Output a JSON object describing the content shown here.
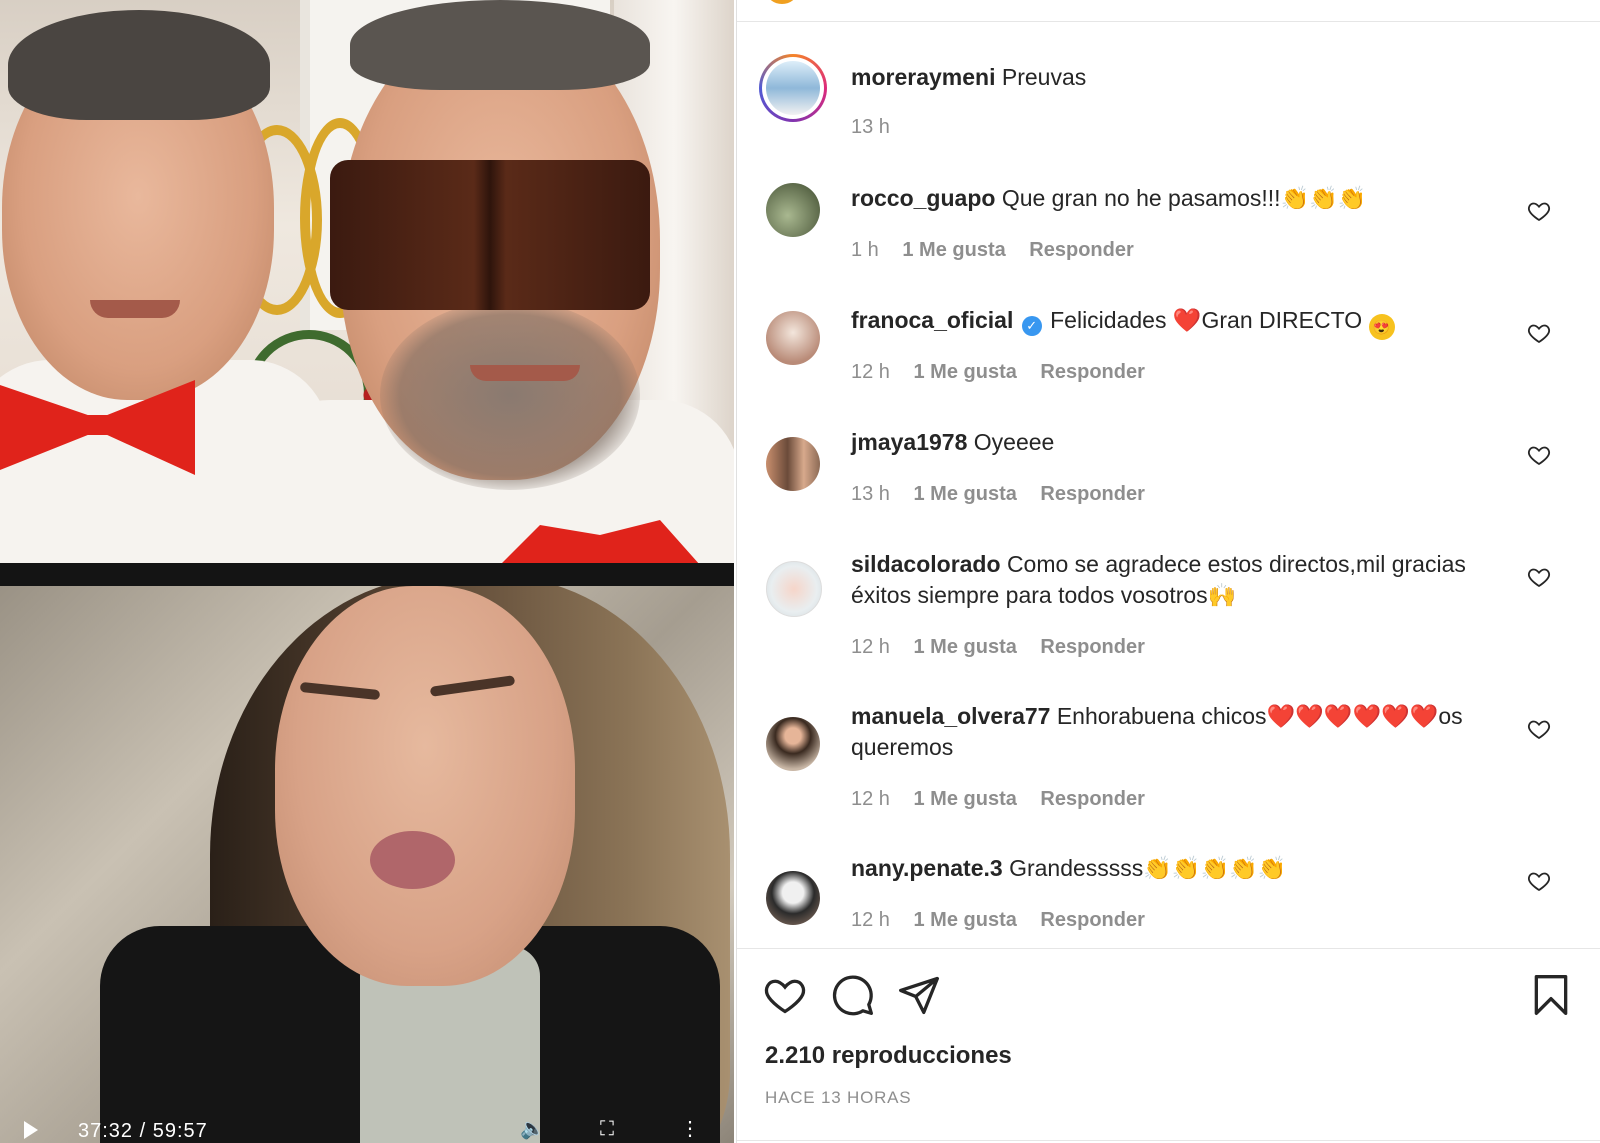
{
  "video": {
    "time": "37:32 / 59:57"
  },
  "post": {
    "caption_user": "moreraymeni",
    "caption_text": "Preuvas",
    "caption_time": "13 h",
    "views": "2.210 reproducciones",
    "posted": "HACE 13 HORAS"
  },
  "comments": [
    {
      "user": "rocco_guapo",
      "text": "Que gran no he pasamos!!!",
      "emoji": "👏👏👏",
      "time": "1 h",
      "likes": "1 Me gusta",
      "reply": "Responder"
    },
    {
      "user": "franoca_oficial",
      "verified": "✓",
      "text_a": "Felicidades",
      "heart": "❤️",
      "text_b": "Gran DIRECTO",
      "emoji": "😍",
      "time": "12 h",
      "likes": "1 Me gusta",
      "reply": "Responder"
    },
    {
      "user": "jmaya1978",
      "text": "Oyeeee",
      "time": "13 h",
      "likes": "1 Me gusta",
      "reply": "Responder"
    },
    {
      "user": "sildacolorado",
      "text": "Como se agradece estos directos,mil gracias éxitos siempre para todos vosotros",
      "emoji": "🙌",
      "time": "12 h",
      "likes": "1 Me gusta",
      "reply": "Responder"
    },
    {
      "user": "manuela_olvera77",
      "text_a": "Enhorabuena chicos",
      "hearts": "❤️❤️❤️❤️❤️❤️",
      "text_b": "os queremos",
      "time": "12 h",
      "likes": "1 Me gusta",
      "reply": "Responder"
    },
    {
      "user": "nany.penate.3",
      "text": "Grandesssss",
      "emoji": "👏👏👏👏👏",
      "time": "12 h",
      "likes": "1 Me gusta",
      "reply": "Responder"
    }
  ],
  "icons": {
    "like": "heart-icon",
    "comment": "comment-icon",
    "share": "send-icon",
    "save": "bookmark-icon"
  },
  "colors": {
    "text": "#262626",
    "muted": "#8e8e8e",
    "verified": "#3897f0",
    "bowtie": "#e0231b"
  }
}
